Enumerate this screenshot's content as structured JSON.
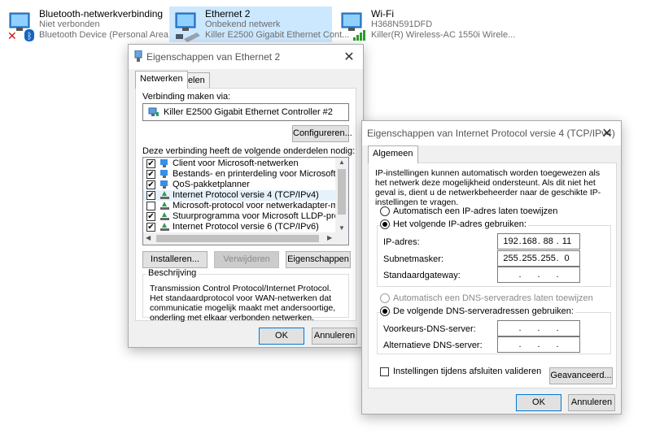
{
  "connections": [
    {
      "name": "Bluetooth-netwerkverbinding",
      "status": "Niet verbonden",
      "device": "Bluetooth Device (Personal Area ..."
    },
    {
      "name": "Ethernet 2",
      "status": "Onbekend netwerk",
      "device": "Killer E2500 Gigabit Ethernet Cont..."
    },
    {
      "name": "Wi-Fi",
      "status": "H368N591DFD",
      "device": "Killer(R) Wireless-AC 1550i Wirele..."
    }
  ],
  "eth_dialog": {
    "title": "Eigenschappen van Ethernet 2",
    "tabs": [
      "Netwerken",
      "Delen"
    ],
    "connect_via_label": "Verbinding maken via:",
    "adapter": "Killer E2500 Gigabit Ethernet Controller #2",
    "configure_button": "Configureren...",
    "components_label": "Deze verbinding heeft de volgende onderdelen nodig:",
    "components": [
      {
        "label": "Client voor Microsoft-netwerken",
        "checked": true
      },
      {
        "label": "Bestands- en printerdeling voor Microsoft-netwerken",
        "checked": true
      },
      {
        "label": "QoS-pakketplanner",
        "checked": true
      },
      {
        "label": "Internet Protocol versie 4 (TCP/IPv4)",
        "checked": true
      },
      {
        "label": "Microsoft-protocol voor netwerkadapter-multiplexor",
        "checked": false
      },
      {
        "label": "Stuurprogramma voor Microsoft LLDP-protocol",
        "checked": true
      },
      {
        "label": "Internet Protocol versie 6 (TCP/IPv6)",
        "checked": true
      }
    ],
    "install_button": "Installeren...",
    "remove_button": "Verwijderen",
    "properties_button": "Eigenschappen",
    "description_title": "Beschrijving",
    "description": "Transmission Control Protocol/Internet Protocol. Het standaardprotocol voor WAN-netwerken dat communicatie mogelijk maakt met andersoortige, onderling met elkaar verbonden netwerken.",
    "ok_button": "OK",
    "cancel_button": "Annuleren"
  },
  "ipv4_dialog": {
    "title": "Eigenschappen van Internet Protocol versie 4 (TCP/IPv4)",
    "tab": "Algemeen",
    "intro": "IP-instellingen kunnen automatisch worden toegewezen als het netwerk deze mogelijkheid ondersteunt. Als dit niet het geval is, dient u de netwerkbeheerder naar de geschikte IP-instellingen te vragen.",
    "auto_ip_label": "Automatisch een IP-adres laten toewijzen",
    "manual_ip_label": "Het volgende IP-adres gebruiken:",
    "ip_label": "IP-adres:",
    "ip_value": [
      "192",
      "168",
      "88",
      "11"
    ],
    "subnet_label": "Subnetmasker:",
    "subnet_value": [
      "255",
      "255",
      "255",
      "0"
    ],
    "gateway_label": "Standaardgateway:",
    "auto_dns_label": "Automatisch een DNS-serveradres laten toewijzen",
    "manual_dns_label": "De volgende DNS-serveradressen gebruiken:",
    "preferred_dns_label": "Voorkeurs-DNS-server:",
    "alternate_dns_label": "Alternatieve DNS-server:",
    "validate_label": "Instellingen tijdens afsluiten valideren",
    "advanced_button": "Geavanceerd...",
    "ok_button": "OK",
    "cancel_button": "Annuleren"
  }
}
